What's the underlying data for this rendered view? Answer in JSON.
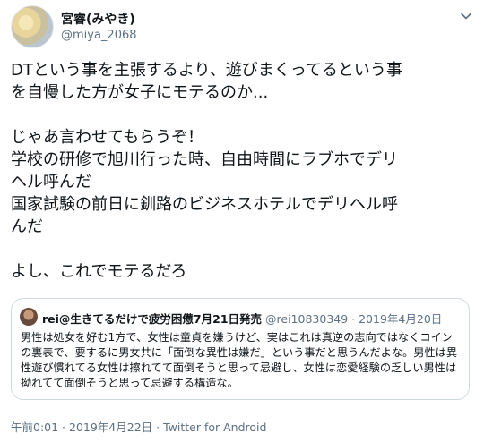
{
  "author": {
    "name": "宮睿(みやき)",
    "handle": "@miya_2068"
  },
  "menu_icon": "chevron-down-icon",
  "tweet": {
    "text": "DTという事を主張するより、遊びまくってるという事\nを自慢した方が女子にモテるのか...\n\nじゃあ言わせてもらうぞ！\n学校の研修で旭川行った時、自由時間にラブホでデリ\nヘル呼んだ\n国家試験の前日に釧路のビジネスホテルでデリヘル呼\nんだ\n\nよし、これでモテるだろ"
  },
  "quoted": {
    "name": "rei@生きてるだけで疲労困憊7月21日発売",
    "meta": "@rei10830349 · 2019年4月20日",
    "text": "男性は処女を好む1方で、女性は童貞を嫌うけど、実はこれは真逆の志向ではなくコインの裏表で、要するに男女共に「面倒な異性は嫌だ」という事だと思うんだよな。男性は異性遊び慣れてる女性は擦れてて面倒そうと思って忌避し、女性は恋愛経験の乏しい男性は拗れてて面倒そうと思って忌避する構造な。"
  },
  "footer": {
    "text": "午前0:01 · 2019年4月22日 · Twitter for Android"
  },
  "colors": {
    "text": "#0f1419",
    "secondary": "#5b7083",
    "border": "#cfd9de"
  }
}
